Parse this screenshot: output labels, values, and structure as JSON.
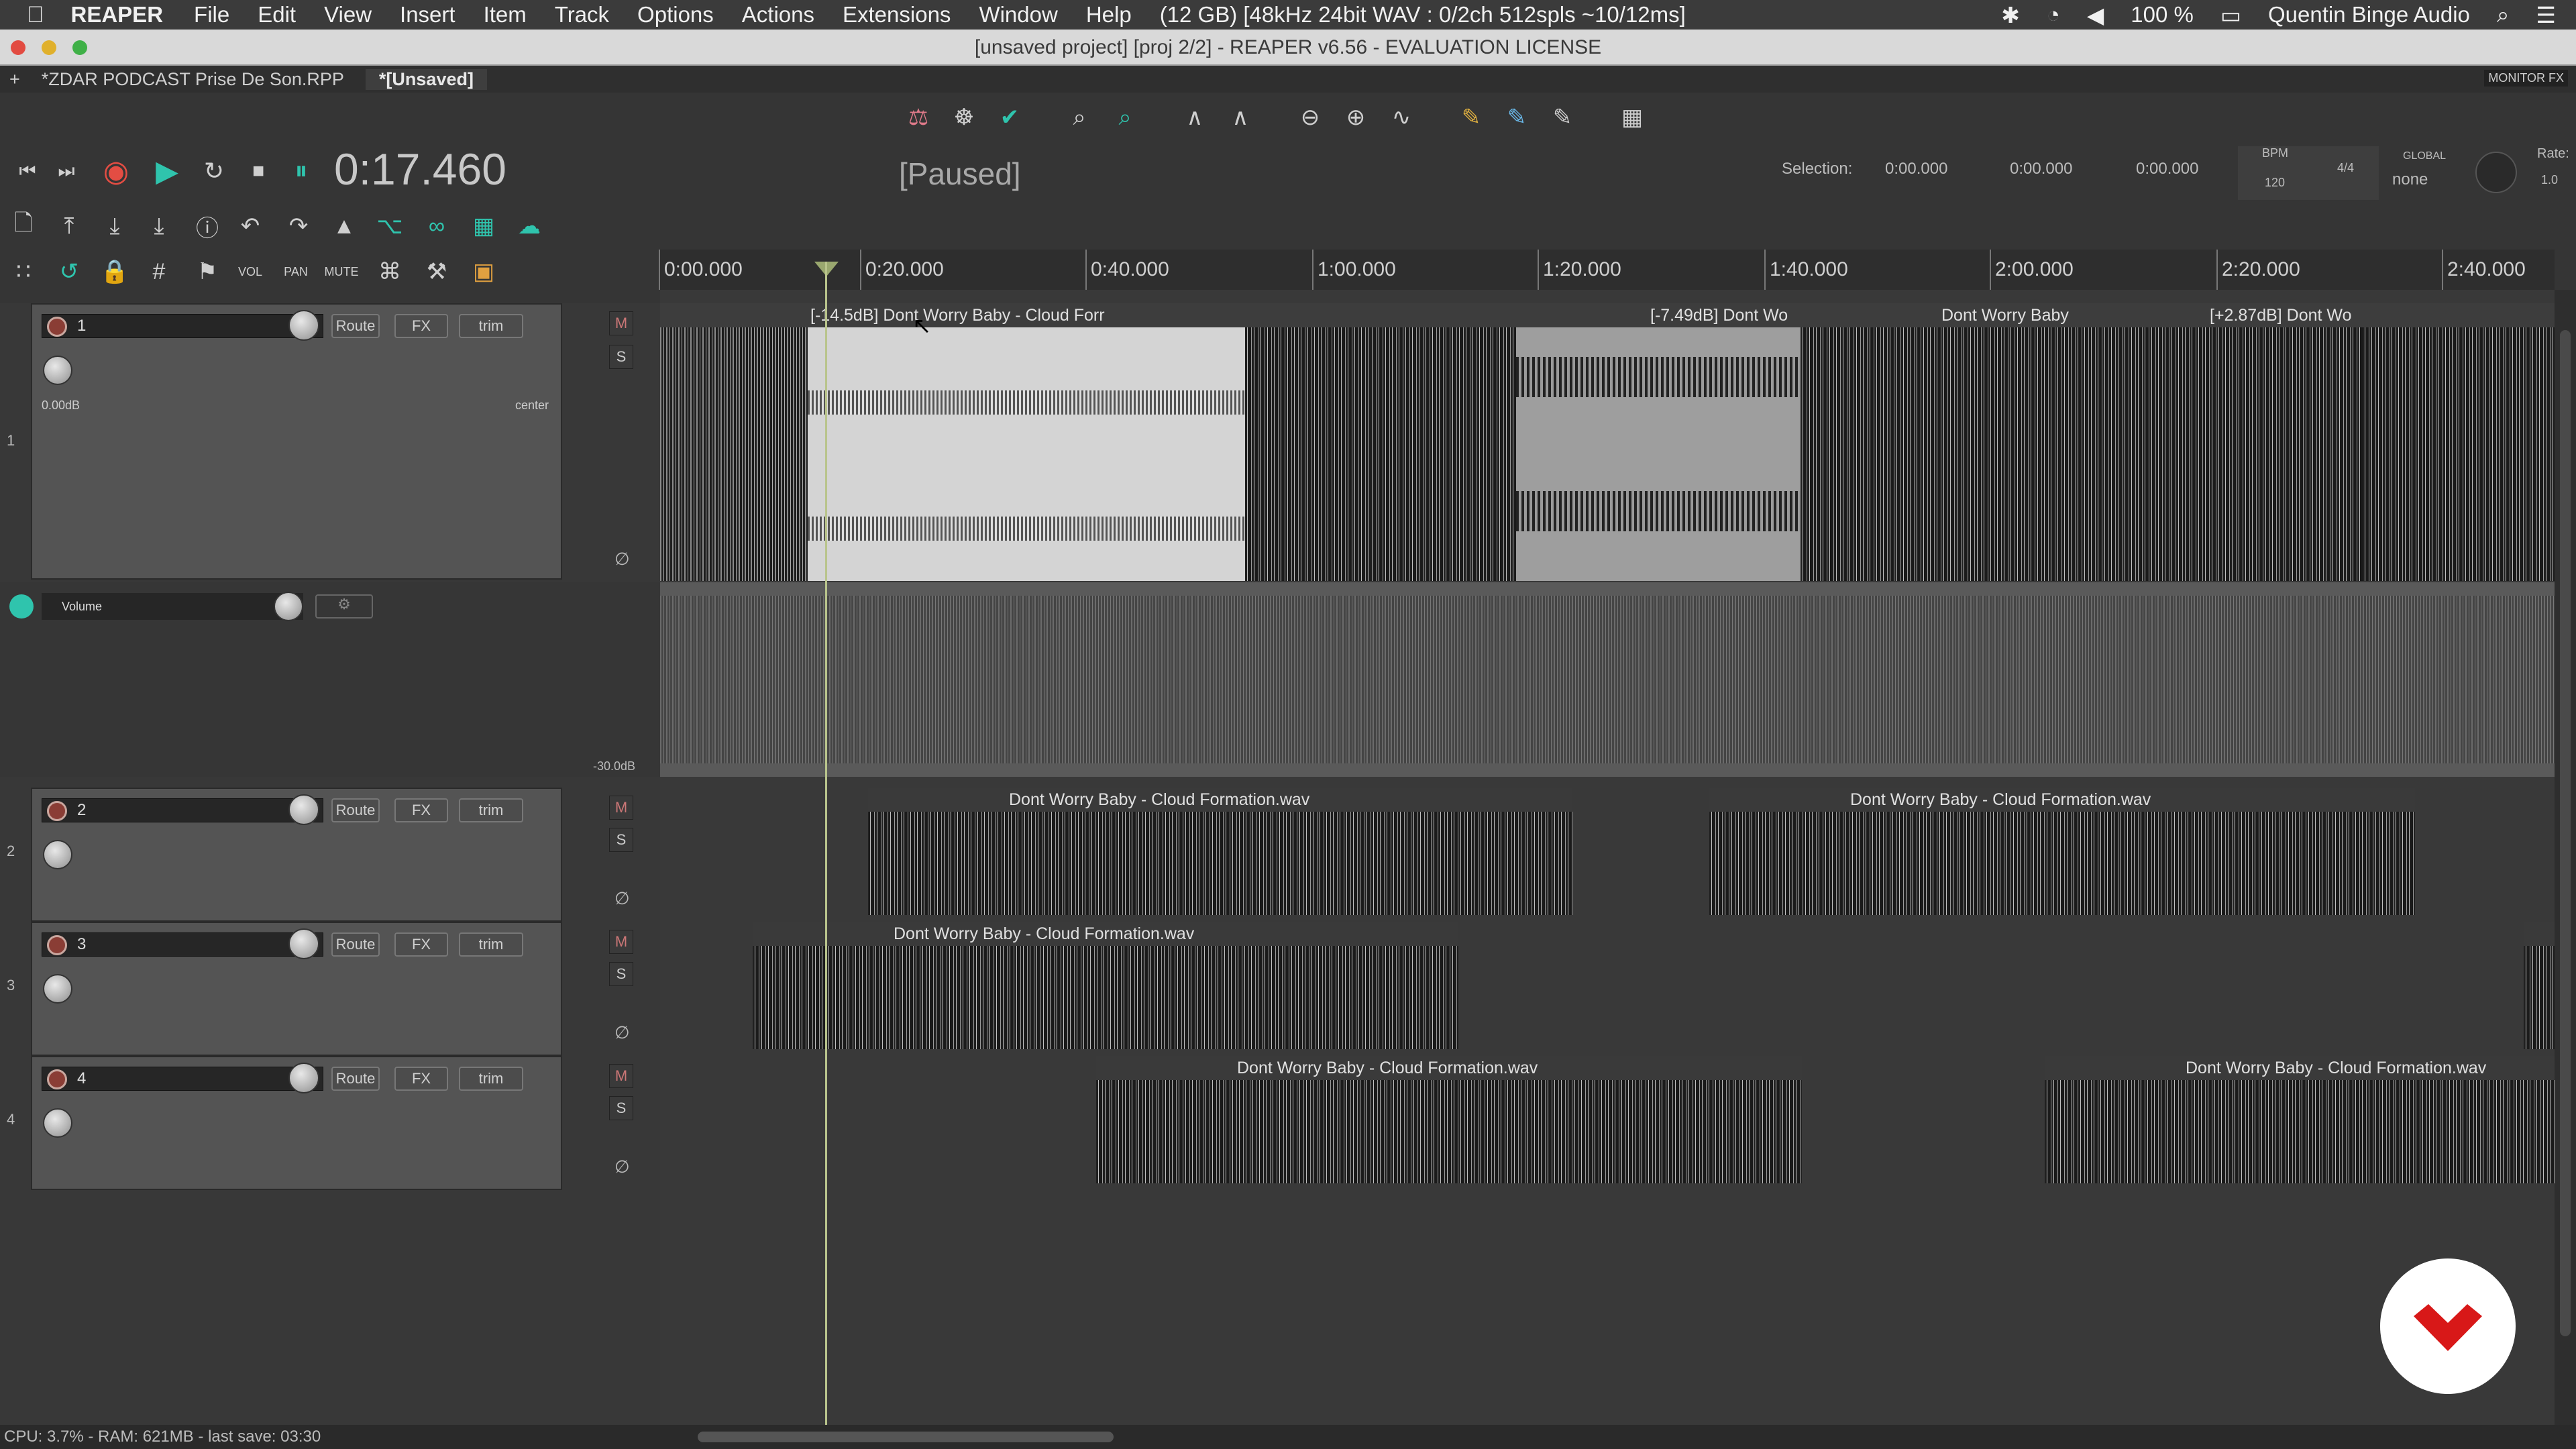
{
  "menubar": {
    "app": "REAPER",
    "items": [
      "File",
      "Edit",
      "View",
      "Insert",
      "Item",
      "Track",
      "Options",
      "Actions",
      "Extensions",
      "Window",
      "Help"
    ],
    "status": "(12 GB) [48kHz 24bit WAV : 0/2ch 512spls ~10/12ms]",
    "battery": "100 %",
    "user": "Quentin Binge Audio"
  },
  "window": {
    "title": "[unsaved project] [proj 2/2] - REAPER v6.56 - EVALUATION LICENSE"
  },
  "tabs": {
    "tab1": "*ZDAR  PODCAST  Prise De Son.RPP",
    "tab2": "*[Unsaved]",
    "monitor_fx": "MONITOR FX"
  },
  "transport": {
    "time": "0:17.460",
    "state": "[Paused]"
  },
  "selection": {
    "label": "Selection:",
    "start": "0:00.000",
    "end": "0:00.000",
    "length": "0:00.000"
  },
  "tempo": {
    "bpm_label": "BPM",
    "bpm": "120",
    "sig": "4/4",
    "global_label": "GLOBAL",
    "global_value": "none",
    "rate_label": "Rate:",
    "rate": "1.0"
  },
  "ruler": [
    "0:00.000",
    "0:20.000",
    "0:40.000",
    "1:00.000",
    "1:20.000",
    "1:40.000",
    "2:00.000",
    "2:20.000",
    "2:40.000"
  ],
  "tracks": [
    {
      "num": "1",
      "name": "1",
      "route": "Route",
      "fx": "FX",
      "trim": "trim",
      "vol": "0.00dB",
      "pan": "center",
      "m": "M",
      "s": "S"
    },
    {
      "num": "2",
      "name": "2",
      "route": "Route",
      "fx": "FX",
      "trim": "trim",
      "m": "M",
      "s": "S"
    },
    {
      "num": "3",
      "name": "3",
      "route": "Route",
      "fx": "FX",
      "trim": "trim",
      "m": "M",
      "s": "S"
    },
    {
      "num": "4",
      "name": "4",
      "route": "Route",
      "fx": "FX",
      "trim": "trim",
      "m": "M",
      "s": "S"
    }
  ],
  "envelope": {
    "name": "Volume",
    "min_label": "-30.0dB"
  },
  "items": {
    "t1_a": "[-14.5dB] Dont Worry Baby - Cloud Forr",
    "t1_b": "[-7.49dB] Dont Wo",
    "t1_c": "Dont Worry Baby",
    "t1_d": "[+2.87dB] Dont Wo",
    "t2_a": "Dont Worry Baby - Cloud Formation.wav",
    "t2_b": "Dont Worry Baby - Cloud Formation.wav",
    "t3_a": "Dont Worry Baby - Cloud Formation.wav",
    "t4_a": "Dont Worry Baby - Cloud Formation.wav",
    "t4_b": "Dont Worry Baby - Cloud Formation.wav"
  },
  "status": "CPU: 3.7% - RAM: 621MB - last save: 03:30",
  "colors": {
    "teal": "#2fc4ad",
    "record": "#c9423a",
    "playhead": "#b9c48c"
  }
}
